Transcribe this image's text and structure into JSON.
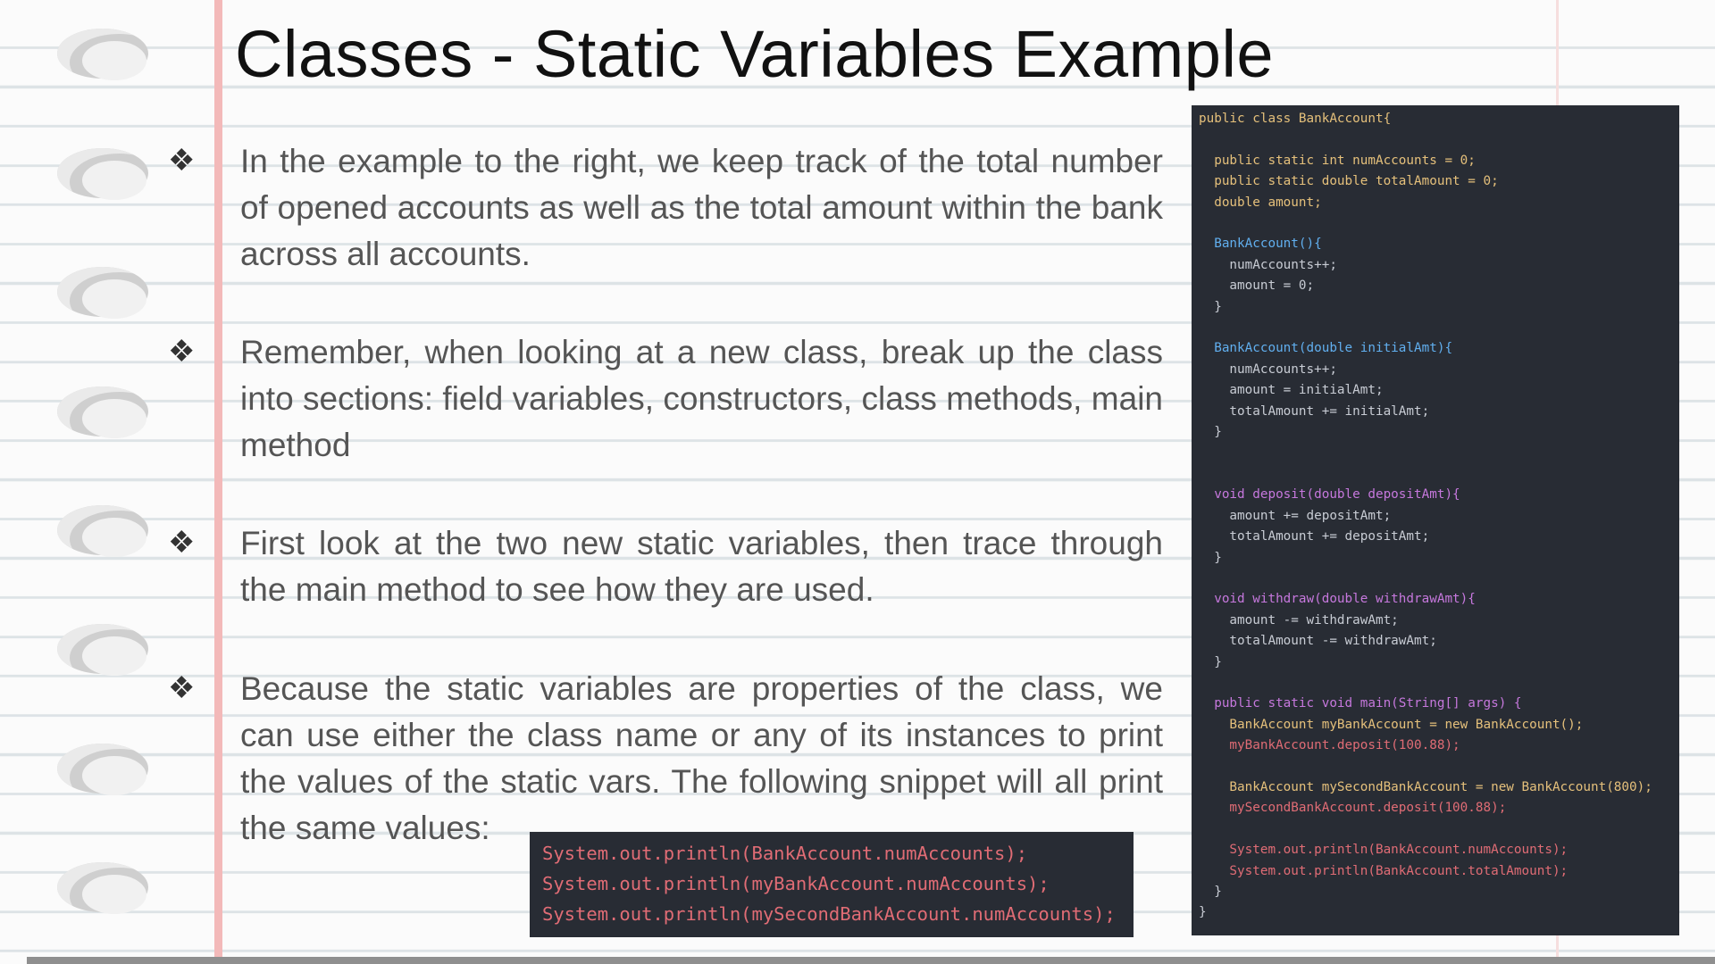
{
  "title": "Classes - Static Variables Example",
  "bullet_symbol": "❖",
  "paragraphs": [
    "In the example to the right, we keep track of the total number of opened accounts as well as the total amount within the bank across all accounts.",
    "Remember, when looking at a new class, break up the class into sections: field variables, constructors, class methods, main method",
    "First look at the two new static variables, then trace through the main method to see how they are used.",
    "Because the static variables are properties of the class, we can use either the class name or any of its instances to print the values of the static vars. The following snippet will all print the same values:"
  ],
  "code": {
    "class_decl": "public class BankAccount{",
    "field1": "  public static int numAccounts = 0;",
    "field2": "  public static double totalAmount = 0;",
    "field3": "  double amount;",
    "ctor1_head": "  BankAccount(){",
    "ctor1_l1": "    numAccounts++;",
    "ctor1_l2": "    amount = 0;",
    "close2": "  }",
    "ctor2_head": "  BankAccount(double initialAmt){",
    "ctor2_l1": "    numAccounts++;",
    "ctor2_l2": "    amount = initialAmt;",
    "ctor2_l3": "    totalAmount += initialAmt;",
    "deposit_head": "  void deposit(double depositAmt){",
    "deposit_l1": "    amount += depositAmt;",
    "deposit_l2": "    totalAmount += depositAmt;",
    "withdraw_head": "  void withdraw(double withdrawAmt){",
    "withdraw_l1": "    amount -= withdrawAmt;",
    "withdraw_l2": "    totalAmount -= withdrawAmt;",
    "main_head": "  public static void main(String[] args) {",
    "main_l1": "    BankAccount myBankAccount = new BankAccount();",
    "main_l2": "    myBankAccount.deposit(100.88);",
    "main_l3": "    BankAccount mySecondBankAccount = new BankAccount(800);",
    "main_l4": "    mySecondBankAccount.deposit(100.88);",
    "main_l5": "    System.out.println(BankAccount.numAccounts);",
    "main_l6": "    System.out.println(BankAccount.totalAmount);",
    "close0": "}"
  },
  "snippet": [
    "System.out.println(BankAccount.numAccounts);",
    "System.out.println(myBankAccount.numAccounts);",
    "System.out.println(mySecondBankAccount.numAccounts);"
  ]
}
